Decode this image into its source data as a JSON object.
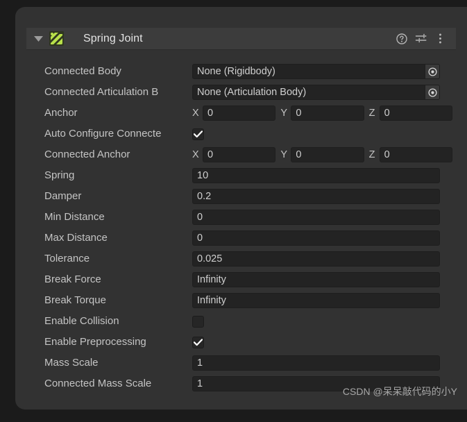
{
  "panel": {
    "header": {
      "title": "Spring Joint",
      "foldout_state": "expanded",
      "icon_name": "spring-joint-icon",
      "icons": [
        {
          "name": "help-icon",
          "label": "?"
        },
        {
          "name": "preset-icon",
          "label": "Preset"
        },
        {
          "name": "more-menu-icon",
          "label": "⋮"
        }
      ]
    },
    "rows": [
      {
        "label": "Connected Body",
        "type": "object",
        "value": "None (Rigidbody)",
        "name": "connected-body"
      },
      {
        "label": "Connected Articulation B",
        "type": "object",
        "value": "None (Articulation Body)",
        "name": "connected-articulation-body"
      },
      {
        "label": "Anchor",
        "type": "vector3",
        "axes": [
          "X",
          "Y",
          "Z"
        ],
        "values": [
          "0",
          "0",
          "0"
        ],
        "name": "anchor"
      },
      {
        "label": "Auto Configure Connecte",
        "type": "checkbox",
        "checked": true,
        "name": "auto-configure-connected-anchor"
      },
      {
        "label": "Connected Anchor",
        "type": "vector3",
        "axes": [
          "X",
          "Y",
          "Z"
        ],
        "values": [
          "0",
          "0",
          "0"
        ],
        "name": "connected-anchor"
      },
      {
        "label": "Spring",
        "type": "text",
        "value": "10",
        "name": "spring"
      },
      {
        "label": "Damper",
        "type": "text",
        "value": "0.2",
        "name": "damper"
      },
      {
        "label": "Min Distance",
        "type": "text",
        "value": "0",
        "name": "min-distance"
      },
      {
        "label": "Max Distance",
        "type": "text",
        "value": "0",
        "name": "max-distance"
      },
      {
        "label": "Tolerance",
        "type": "text",
        "value": "0.025",
        "name": "tolerance"
      },
      {
        "label": "Break Force",
        "type": "text",
        "value": "Infinity",
        "name": "break-force"
      },
      {
        "label": "Break Torque",
        "type": "text",
        "value": "Infinity",
        "name": "break-torque"
      },
      {
        "label": "Enable Collision",
        "type": "checkbox",
        "checked": false,
        "name": "enable-collision"
      },
      {
        "label": "Enable Preprocessing",
        "type": "checkbox",
        "checked": true,
        "name": "enable-preprocessing"
      },
      {
        "label": "Mass Scale",
        "type": "text",
        "value": "1",
        "name": "mass-scale"
      },
      {
        "label": "Connected Mass Scale",
        "type": "text",
        "value": "1",
        "name": "connected-mass-scale"
      }
    ]
  },
  "watermark": {
    "text": "CSDN @呆呆敲代码的小Y"
  },
  "colors": {
    "panel_bg": "#323232",
    "header_bg": "#3c3c3c",
    "field_bg": "#232323",
    "label_text": "#c4c4c4",
    "value_text": "#cfcfcf",
    "title_text": "#e3e3e3",
    "accent_icon": "#b8e04a",
    "page_bg": "#1b1b1b"
  }
}
